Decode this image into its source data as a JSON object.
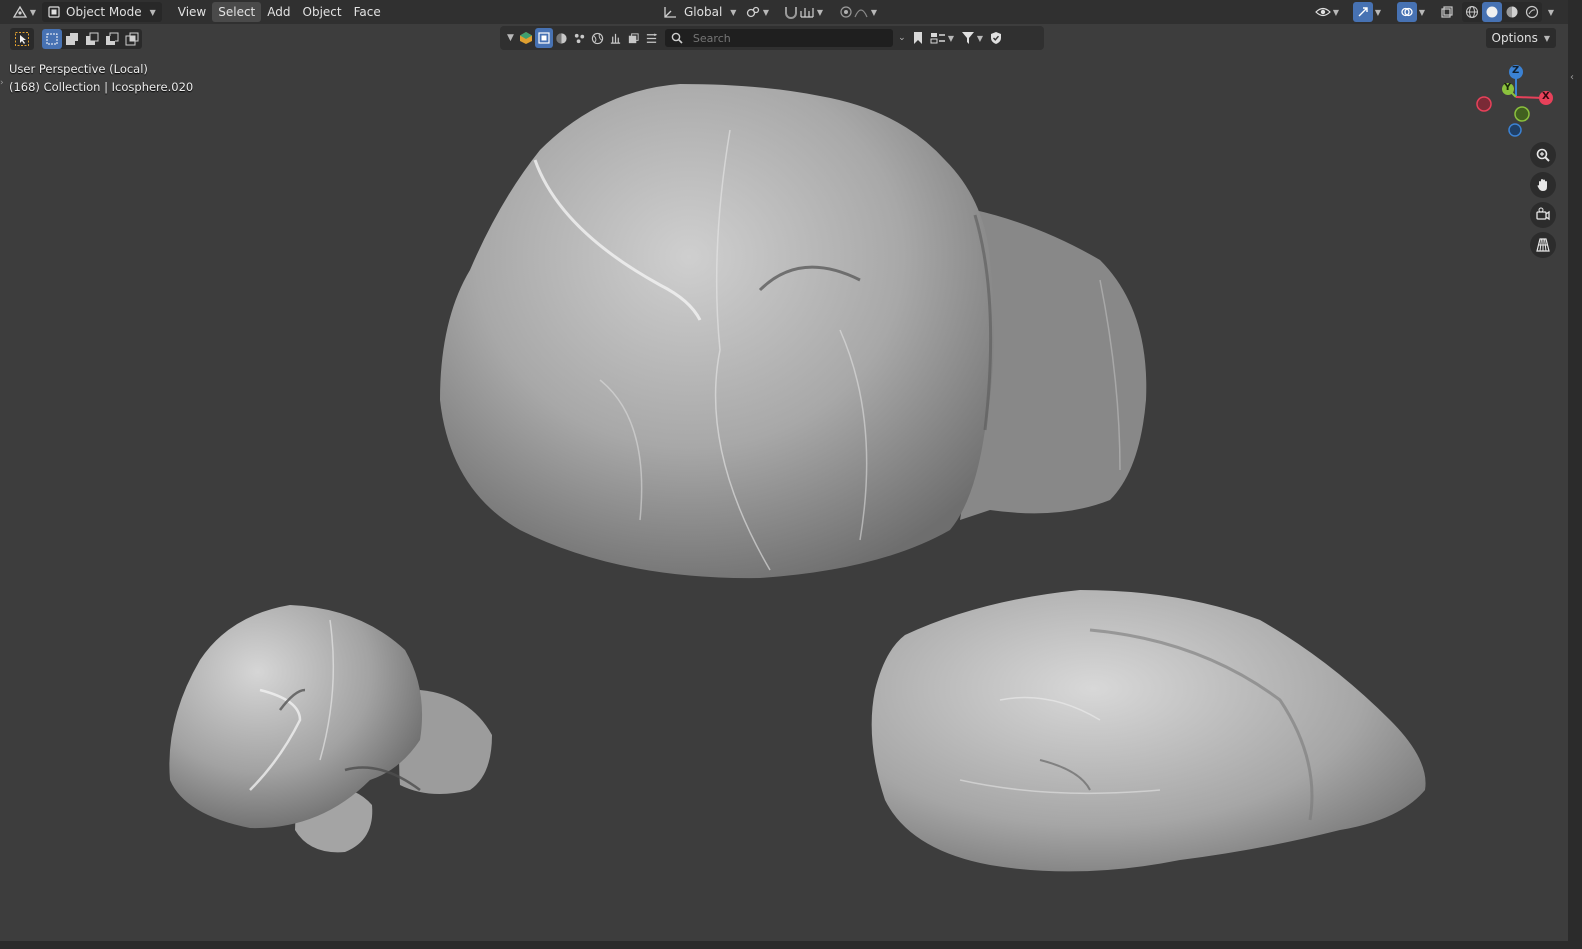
{
  "header": {
    "editor_type_icon": "viewport-editor-icon",
    "mode_label": "Object Mode",
    "menu": [
      "View",
      "Select",
      "Add",
      "Object",
      "Face"
    ],
    "active_menu": "Select",
    "transform_orientation": "Global"
  },
  "toolbar": {
    "search_placeholder": "Search",
    "options_label": "Options"
  },
  "viewport": {
    "perspective_label": "User Perspective (Local)",
    "collection_label": "(168) Collection | Icosphere.020",
    "gizmo_axes": [
      "Z",
      "Y",
      "X"
    ]
  },
  "colors": {
    "accent": "#4772b3",
    "background": "#3d3d3d",
    "axis_x": "#e8415a",
    "axis_y": "#8bc13d",
    "axis_z": "#3b82d4"
  }
}
